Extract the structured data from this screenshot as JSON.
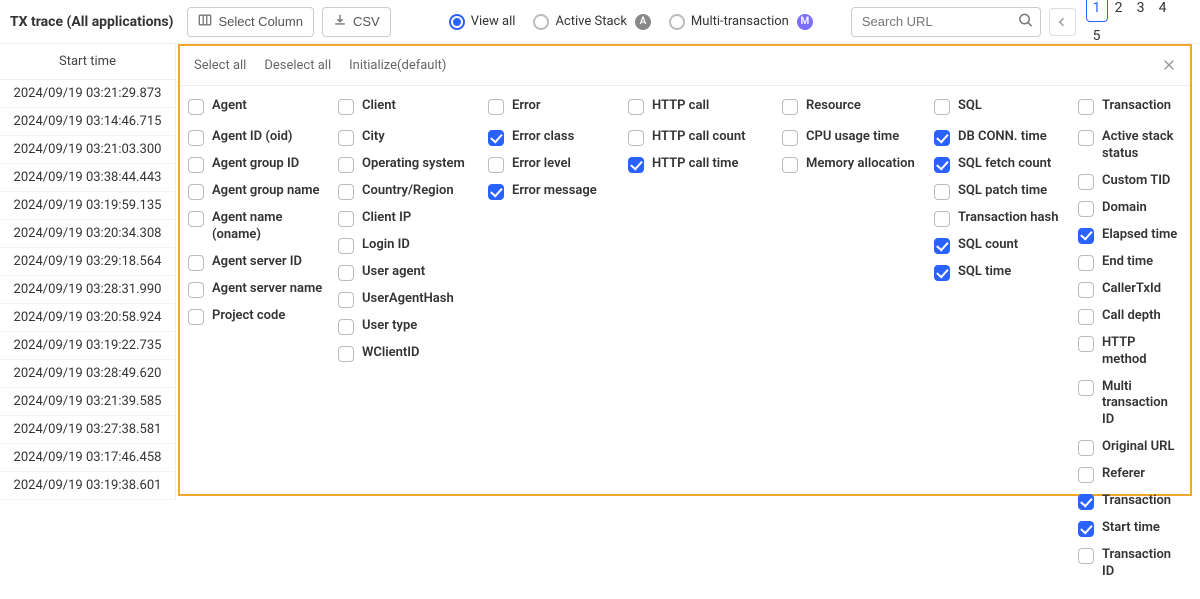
{
  "header": {
    "title": "TX trace (All applications)",
    "select_column": "Select Column",
    "csv": "CSV",
    "view_all": "View all",
    "active_stack": "Active Stack",
    "multi_tx": "Multi-transaction",
    "search_placeholder": "Search URL",
    "pages": [
      "1",
      "2",
      "3",
      "4",
      "5"
    ],
    "active_page": "1"
  },
  "left": {
    "col_header": "Start time",
    "rows": [
      "2024/09/19 03:21:29.873",
      "2024/09/19 03:14:46.715",
      "2024/09/19 03:21:03.300",
      "2024/09/19 03:38:44.443",
      "2024/09/19 03:19:59.135",
      "2024/09/19 03:20:34.308",
      "2024/09/19 03:29:18.564",
      "2024/09/19 03:28:31.990",
      "2024/09/19 03:20:58.924",
      "2024/09/19 03:19:22.735",
      "2024/09/19 03:28:49.620",
      "2024/09/19 03:21:39.585",
      "2024/09/19 03:27:38.581",
      "2024/09/19 03:17:46.458",
      "2024/09/19 03:19:38.601"
    ]
  },
  "popup": {
    "select_all": "Select all",
    "deselect_all": "Deselect all",
    "initialize": "Initialize(default)",
    "cols": [
      {
        "header": "Agent",
        "items": [
          {
            "label": "Agent ID (oid)",
            "checked": false
          },
          {
            "label": "Agent group ID",
            "checked": false
          },
          {
            "label": "Agent group name",
            "checked": false
          },
          {
            "label": "Agent name (oname)",
            "checked": false
          },
          {
            "label": "Agent server ID",
            "checked": false
          },
          {
            "label": "Agent server name",
            "checked": false
          },
          {
            "label": "Project code",
            "checked": false
          }
        ]
      },
      {
        "header": "Client",
        "items": [
          {
            "label": "City",
            "checked": false
          },
          {
            "label": "Operating system",
            "checked": false
          },
          {
            "label": "Country/Region",
            "checked": false
          },
          {
            "label": "Client IP",
            "checked": false
          },
          {
            "label": "Login ID",
            "checked": false
          },
          {
            "label": "User agent",
            "checked": false
          },
          {
            "label": "UserAgentHash",
            "checked": false
          },
          {
            "label": "User type",
            "checked": false
          },
          {
            "label": "WClientID",
            "checked": false
          }
        ]
      },
      {
        "header": "Error",
        "items": [
          {
            "label": "Error class",
            "checked": true
          },
          {
            "label": "Error level",
            "checked": false
          },
          {
            "label": "Error message",
            "checked": true
          }
        ]
      },
      {
        "header": "HTTP call",
        "items": [
          {
            "label": "HTTP call count",
            "checked": false
          },
          {
            "label": "HTTP call time",
            "checked": true
          }
        ]
      },
      {
        "header": "Resource",
        "items": [
          {
            "label": "CPU usage time",
            "checked": false
          },
          {
            "label": "Memory allocation",
            "checked": false
          }
        ]
      },
      {
        "header": "SQL",
        "items": [
          {
            "label": "DB CONN. time",
            "checked": true
          },
          {
            "label": "SQL fetch count",
            "checked": true
          },
          {
            "label": "SQL patch time",
            "checked": false
          },
          {
            "label": "Transaction hash",
            "checked": false
          },
          {
            "label": "SQL count",
            "checked": true
          },
          {
            "label": "SQL time",
            "checked": true
          }
        ]
      },
      {
        "header": "Transaction",
        "items": [
          {
            "label": "Active stack status",
            "checked": false
          },
          {
            "label": "Custom TID",
            "checked": false
          },
          {
            "label": "Domain",
            "checked": false
          },
          {
            "label": "Elapsed time",
            "checked": true
          },
          {
            "label": "End time",
            "checked": false
          },
          {
            "label": "CallerTxId",
            "checked": false
          },
          {
            "label": "Call depth",
            "checked": false
          },
          {
            "label": "HTTP method",
            "checked": false
          },
          {
            "label": "Multi transaction ID",
            "checked": false
          },
          {
            "label": "Original URL",
            "checked": false
          },
          {
            "label": "Referer",
            "checked": false
          },
          {
            "label": "Transaction",
            "checked": true
          },
          {
            "label": "Start time",
            "checked": true
          },
          {
            "label": "Transaction ID",
            "checked": false
          }
        ]
      }
    ]
  }
}
